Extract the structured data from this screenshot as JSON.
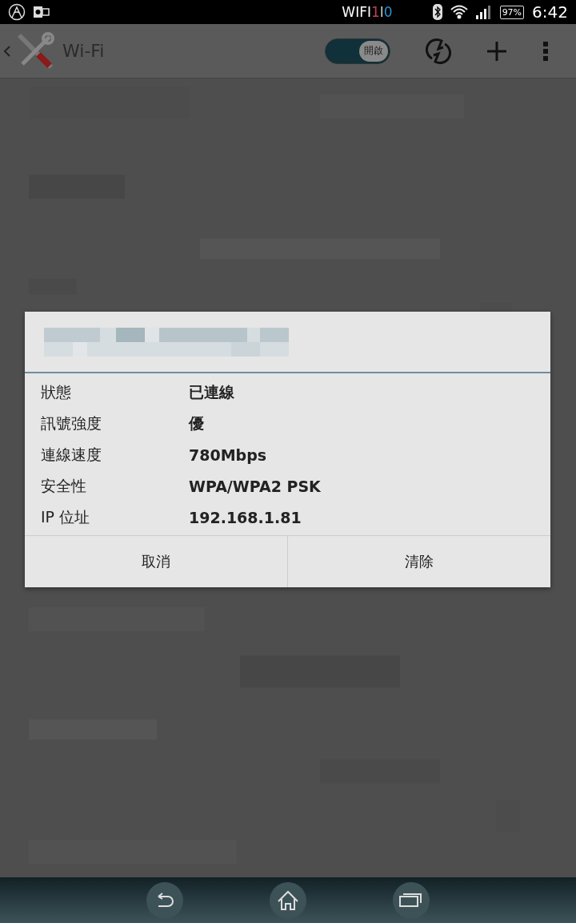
{
  "status_bar": {
    "label": "WIFI",
    "label_marks": [
      {
        "text": "1",
        "color": "#c0405a"
      },
      {
        "text": "I",
        "color": "#c8c8c8"
      },
      {
        "text": "0",
        "color": "#2a8fd0"
      }
    ],
    "battery": "97%",
    "time": "6:42"
  },
  "action_bar": {
    "title": "Wi-Fi",
    "toggle": {
      "label": "開啟",
      "on": true
    }
  },
  "dialog": {
    "rows": [
      {
        "label": "狀態",
        "value": "已連線"
      },
      {
        "label": "訊號強度",
        "value": "優"
      },
      {
        "label": "連線速度",
        "value": "780Mbps"
      },
      {
        "label": "安全性",
        "value": "WPA/WPA2 PSK"
      },
      {
        "label": "IP 位址",
        "value": "192.168.1.81"
      }
    ],
    "buttons": [
      "取消",
      "清除"
    ]
  }
}
